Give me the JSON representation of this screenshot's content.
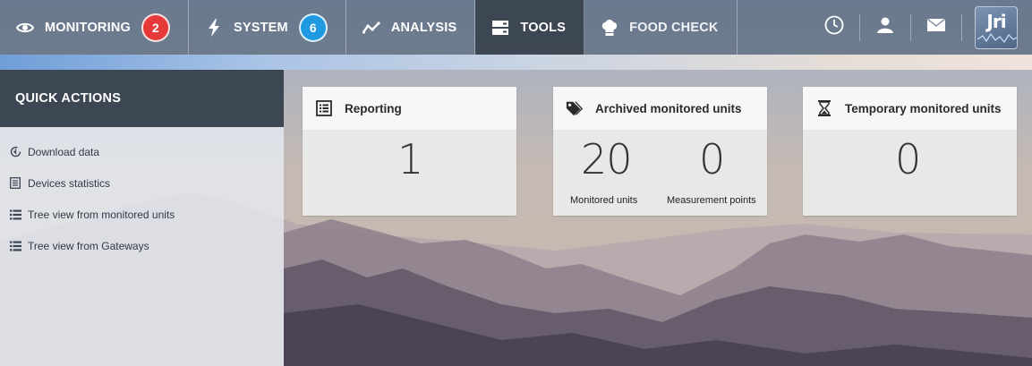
{
  "nav": {
    "items": [
      {
        "label": "MONITORING",
        "icon": "eye-icon",
        "badge": "2",
        "badge_color": "#e63a3a"
      },
      {
        "label": "SYSTEM",
        "icon": "lightning-icon",
        "badge": "6",
        "badge_color": "#1f9ae0"
      },
      {
        "label": "ANALYSIS",
        "icon": "trend-line-icon"
      },
      {
        "label": "TOOLS",
        "icon": "server-icon",
        "active": true
      },
      {
        "label": "FOOD CHECK",
        "icon": "chef-hat-icon"
      }
    ],
    "right_icons": [
      "clock-icon",
      "user-icon",
      "mail-icon"
    ],
    "logo_text": "Jri"
  },
  "sidebar": {
    "title": "QUICK ACTIONS",
    "items": [
      {
        "label": "Download data",
        "icon": "download-icon"
      },
      {
        "label": "Devices statistics",
        "icon": "statistics-icon"
      },
      {
        "label": "Tree view from monitored units",
        "icon": "list-icon"
      },
      {
        "label": "Tree view from Gateways",
        "icon": "list-icon"
      }
    ]
  },
  "cards": {
    "reporting": {
      "title": "Reporting",
      "icon": "report-icon",
      "value": "1"
    },
    "archived": {
      "title": "Archived monitored units",
      "icon": "tags-icon",
      "monitored_value": "20",
      "monitored_label": "Monitored units",
      "points_value": "0",
      "points_label": "Measurement points"
    },
    "temporary": {
      "title": "Temporary monitored units",
      "icon": "hourglass-icon",
      "value": "0"
    }
  },
  "colors": {
    "accent_red": "#e63a3a",
    "accent_blue": "#1f9ae0",
    "sidebar_header": "#3d4753"
  }
}
